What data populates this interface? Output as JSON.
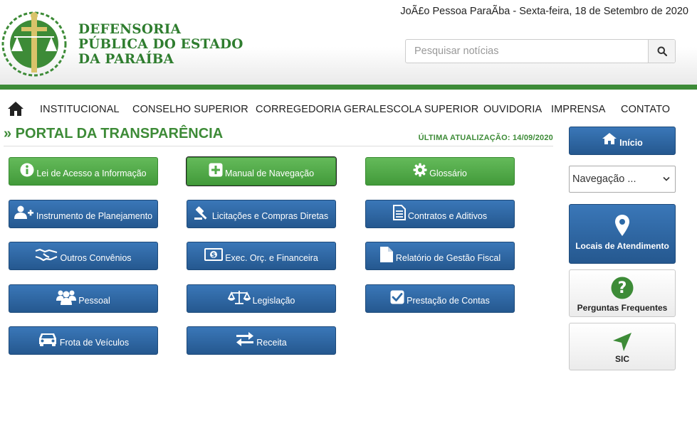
{
  "header": {
    "brand_lines": [
      "DEFENSORIA",
      "PÚBLICA DO ESTADO",
      "DA PARAÍBA"
    ],
    "date_line": "JoÃ£o Pessoa ParaÃba - Sexta-feira, 18 de Setembro de 2020",
    "search_placeholder": "Pesquisar notícias"
  },
  "nav": {
    "items": [
      "INSTITUCIONAL",
      "CONSELHO SUPERIOR",
      "CORREGEDORIA GERAL",
      "ESCOLA SUPERIOR",
      "OUVIDORIA",
      "IMPRENSA",
      "CONTATO"
    ]
  },
  "portal": {
    "title": "» PORTAL DA TRANSPARÊNCIA",
    "last_update": "ÚLTIMA ATUALIZAÇÃO: 14/09/2020"
  },
  "buttons": [
    {
      "label": "Lei de Acesso a Informação",
      "icon": "info-circle-icon",
      "color": "green"
    },
    {
      "label": "Manual de Navegação",
      "icon": "plus-square-icon",
      "color": "green"
    },
    {
      "label": "Glossário",
      "icon": "gear-icon",
      "color": "green"
    },
    {
      "label": "Instrumento de Planejamento",
      "icon": "user-plus-icon",
      "color": "blue"
    },
    {
      "label": "Licitações e Compras Diretas",
      "icon": "gavel-icon",
      "color": "blue"
    },
    {
      "label": "Contratos e Aditivos",
      "icon": "document-icon",
      "color": "blue"
    },
    {
      "label": "Outros Convênios",
      "icon": "handshake-icon",
      "color": "blue"
    },
    {
      "label": "Exec. Orç. e Financeira",
      "icon": "money-icon",
      "color": "blue"
    },
    {
      "label": "Relatório de Gestão Fiscal",
      "icon": "file-icon",
      "color": "blue"
    },
    {
      "label": "Pessoal",
      "icon": "users-icon",
      "color": "blue"
    },
    {
      "label": "Legislação",
      "icon": "scale-icon",
      "color": "blue"
    },
    {
      "label": "Prestação de Contas",
      "icon": "check-square-icon",
      "color": "blue"
    },
    {
      "label": "Frota de Veículos",
      "icon": "car-icon",
      "color": "blue"
    },
    {
      "label": "Receita",
      "icon": "exchange-icon",
      "color": "blue"
    }
  ],
  "sidebar": {
    "inicio": "Início",
    "select_value": "Navegação ...",
    "locais": "Locais de Atendimento",
    "perguntas": "Perguntas Frequentes",
    "sic": "SIC"
  },
  "colors": {
    "brand_green": "#3d8b37",
    "button_blue": "#2e6aa6",
    "button_green": "#52ab48"
  }
}
